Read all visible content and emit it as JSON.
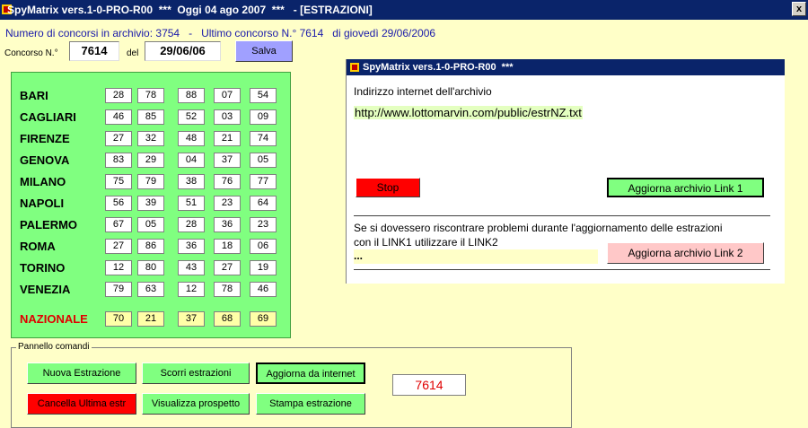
{
  "window": {
    "title": "SpyMatrix vers.1-0-PRO-R00  ***  Oggi 04 ago 2007  ***   - [ESTRAZIONI]",
    "close_label": "x"
  },
  "info": {
    "line": "Numero di concorsi in archivio: 3754   -   Ultimo concorso N.° 7614   di giovedì 29/06/2006"
  },
  "form": {
    "concorso_label": "Concorso N.°",
    "concorso_value": "7614",
    "del_label": "del",
    "date_value": "29/06/06",
    "save_label": "Salva"
  },
  "wheels": [
    {
      "name": "BARI",
      "numbers": [
        "28",
        "78",
        "88",
        "07",
        "54"
      ]
    },
    {
      "name": "CAGLIARI",
      "numbers": [
        "46",
        "85",
        "52",
        "03",
        "09"
      ]
    },
    {
      "name": "FIRENZE",
      "numbers": [
        "27",
        "32",
        "48",
        "21",
        "74"
      ]
    },
    {
      "name": "GENOVA",
      "numbers": [
        "83",
        "29",
        "04",
        "37",
        "05"
      ]
    },
    {
      "name": "MILANO",
      "numbers": [
        "75",
        "79",
        "38",
        "76",
        "77"
      ]
    },
    {
      "name": "NAPOLI",
      "numbers": [
        "56",
        "39",
        "51",
        "23",
        "64"
      ]
    },
    {
      "name": "PALERMO",
      "numbers": [
        "67",
        "05",
        "28",
        "36",
        "23"
      ]
    },
    {
      "name": "ROMA",
      "numbers": [
        "27",
        "86",
        "36",
        "18",
        "06"
      ]
    },
    {
      "name": "TORINO",
      "numbers": [
        "12",
        "80",
        "43",
        "27",
        "19"
      ]
    },
    {
      "name": "VENEZIA",
      "numbers": [
        "79",
        "63",
        "12",
        "78",
        "46"
      ]
    },
    {
      "name": "NAZIONALE",
      "numbers": [
        "70",
        "21",
        "37",
        "68",
        "69"
      ]
    }
  ],
  "popup": {
    "title": "SpyMatrix vers.1-0-PRO-R00  ***",
    "archive_label": "Indirizzo internet dell'archivio",
    "url": "http://www.lottomarvin.com/public/estrNZ.txt",
    "stop_label": "Stop",
    "link1_label": "Aggiorna archivio Link 1",
    "notice_line1": "Se si dovessero riscontrare problemi durante l'aggiornamento delle estrazioni",
    "notice_line2": "con il LINK1 utilizzare il LINK2",
    "status": "...",
    "link2_label": "Aggiorna archivio Link 2"
  },
  "commands": {
    "panel_label": "Pannello comandi",
    "nuova": "Nuova Estrazione",
    "scorri": "Scorri estrazioni",
    "aggiorna": "Aggiorna da internet",
    "cancella": "Cancella Ultima estr",
    "visualizza": "Visualizza prospetto",
    "stampa": "Stampa estrazione",
    "counter": "7614"
  },
  "colors": {
    "title_bg": "#0a246a",
    "panel_green": "#80ff80",
    "button_green": "#80ff80",
    "stop_red": "#ff0000",
    "link2_pink": "#ffc8c8",
    "save_blue": "#a0a0ff",
    "window_bg": "#ffffc8"
  }
}
